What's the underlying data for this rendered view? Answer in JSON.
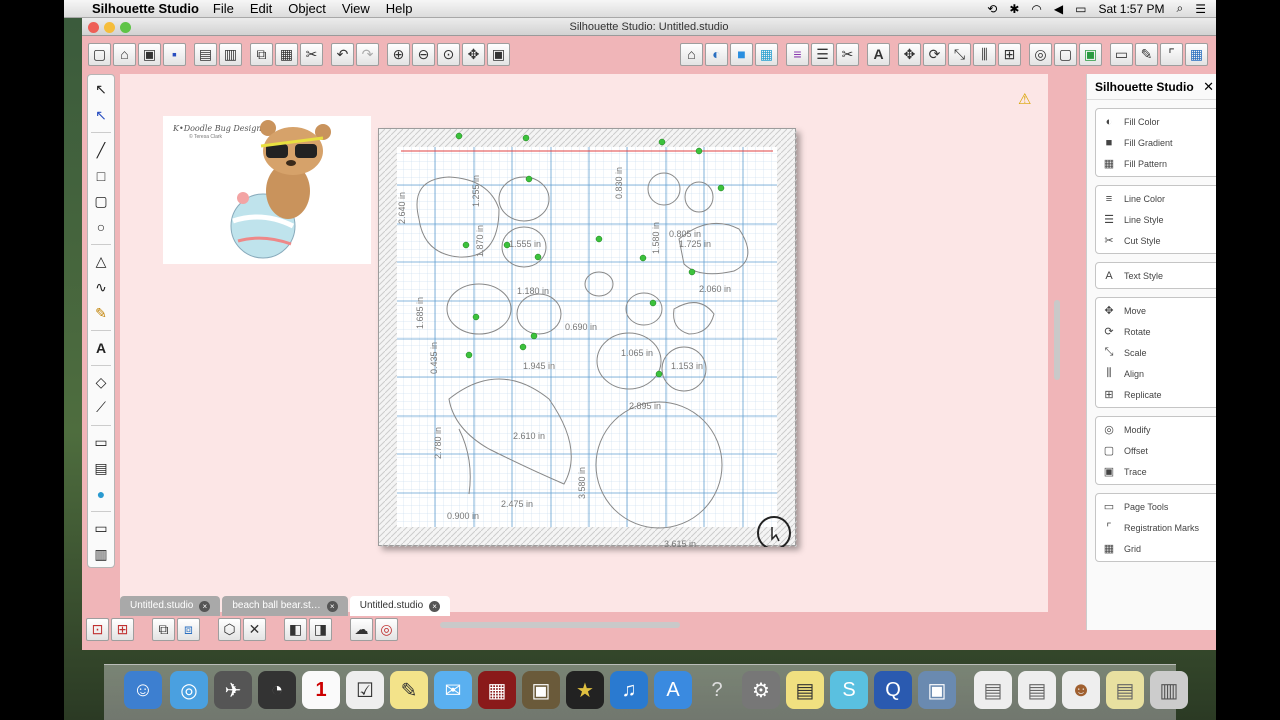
{
  "menubar": {
    "app_name": "Silhouette Studio",
    "menus": [
      "File",
      "Edit",
      "Object",
      "View",
      "Help"
    ],
    "clock": "Sat 1:57 PM"
  },
  "window": {
    "title": "Silhouette Studio: Untitled.studio"
  },
  "artwork": {
    "logo": "K•Doodle Bug Designs",
    "copyright": "© Teresa Clark"
  },
  "dimensions": [
    "2.640 in",
    "1.255 in",
    "0.830 in",
    "1.870 in",
    "1.555 in",
    "1.580 in",
    "0.805 in",
    "1.725 in",
    "2.060 in",
    "1.180 in",
    "1.685 in",
    "0.690 in",
    "1.065 in",
    "0.435 in",
    "1.153 in",
    "1.945 in",
    "2.610 in",
    "2.780 in",
    "3.580 in",
    "2.895 in",
    "2.475 in",
    "0.900 in",
    "3.615 in"
  ],
  "tabs": [
    {
      "label": "Untitled.studio",
      "active": false
    },
    {
      "label": "beach ball bear.st…",
      "active": false
    },
    {
      "label": "Untitled.studio",
      "active": true
    }
  ],
  "right_panel": {
    "title": "Silhouette Studio",
    "groups": [
      [
        {
          "label": "Fill Color",
          "icon": "fill-color-icon"
        },
        {
          "label": "Fill Gradient",
          "icon": "fill-gradient-icon"
        },
        {
          "label": "Fill Pattern",
          "icon": "fill-pattern-icon"
        }
      ],
      [
        {
          "label": "Line Color",
          "icon": "line-color-icon"
        },
        {
          "label": "Line Style",
          "icon": "line-style-icon"
        },
        {
          "label": "Cut Style",
          "icon": "cut-style-icon"
        }
      ],
      [
        {
          "label": "Text Style",
          "icon": "text-style-icon"
        }
      ],
      [
        {
          "label": "Move",
          "icon": "move-icon"
        },
        {
          "label": "Rotate",
          "icon": "rotate-icon"
        },
        {
          "label": "Scale",
          "icon": "scale-icon"
        },
        {
          "label": "Align",
          "icon": "align-icon"
        },
        {
          "label": "Replicate",
          "icon": "replicate-icon"
        }
      ],
      [
        {
          "label": "Modify",
          "icon": "modify-icon"
        },
        {
          "label": "Offset",
          "icon": "offset-icon"
        },
        {
          "label": "Trace",
          "icon": "trace-icon"
        }
      ],
      [
        {
          "label": "Page Tools",
          "icon": "page-tools-icon"
        },
        {
          "label": "Registration Marks",
          "icon": "registration-marks-icon"
        },
        {
          "label": "Grid",
          "icon": "grid-icon"
        }
      ]
    ]
  },
  "colors": {
    "window_bg": "#f0b5b8",
    "canvas_bg": "#fce6e6",
    "grid_line": "#2e7fc0",
    "selection_handle": "#3cc23c"
  }
}
